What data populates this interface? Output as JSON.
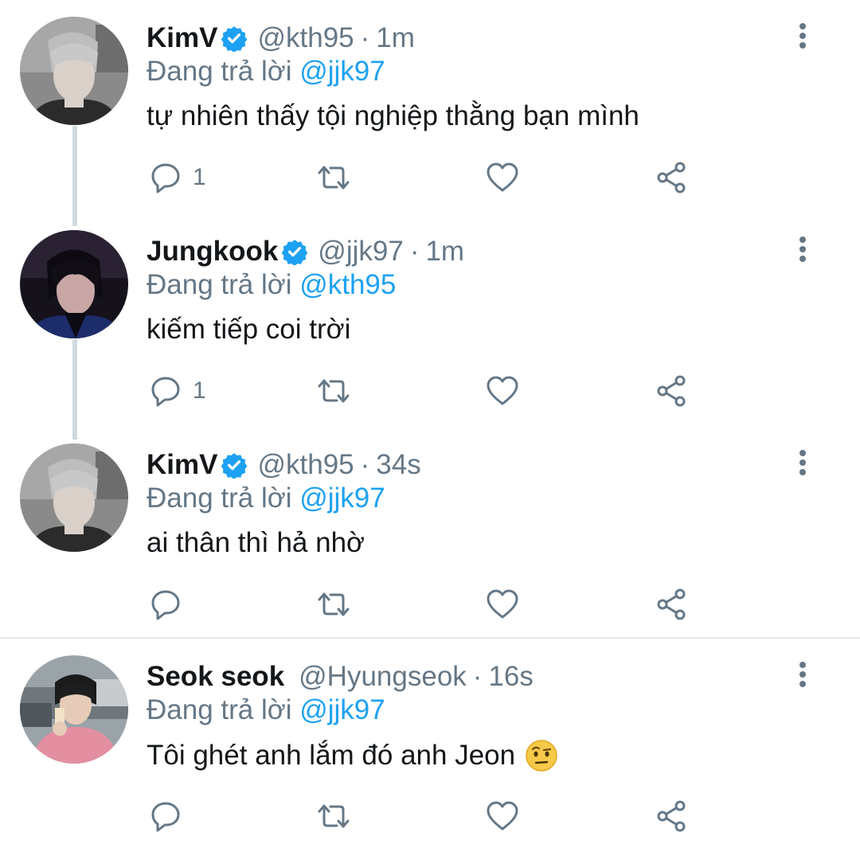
{
  "colors": {
    "text": "#14171a",
    "secondary": "#657786",
    "accent": "#1da1f2",
    "divider": "#e1e8ed"
  },
  "tweets": [
    {
      "name": "KimV",
      "verified": true,
      "handle": "@kth95",
      "separator": "·",
      "time": "1m",
      "replying_prefix": "Đang trả lời",
      "replying_to": "@jjk97",
      "text": "tự nhiên thấy tội nghiệp thằng bạn mình",
      "reply_count": "1",
      "avatar_icon": "avatar-photo"
    },
    {
      "name": "Jungkook",
      "verified": true,
      "handle": "@jjk97",
      "separator": "·",
      "time": "1m",
      "replying_prefix": "Đang trả lời",
      "replying_to": "@kth95",
      "text": "kiếm tiếp coi trời",
      "reply_count": "1",
      "avatar_icon": "avatar-photo"
    },
    {
      "name": "KimV",
      "verified": true,
      "handle": "@kth95",
      "separator": "·",
      "time": "34s",
      "replying_prefix": "Đang trả lời",
      "replying_to": "@jjk97",
      "text": "ai thân thì hả nhờ",
      "reply_count": "",
      "avatar_icon": "avatar-photo"
    },
    {
      "name": "Seok seok",
      "verified": false,
      "handle": "@Hyungseok",
      "separator": "·",
      "time": "16s",
      "replying_prefix": "Đang trả lời",
      "replying_to": "@jjk97",
      "text": "Tôi ghét anh lắm đó anh Jeon",
      "emoji": "raised-eyebrow-emoji",
      "reply_count": "",
      "avatar_icon": "avatar-photo"
    }
  ],
  "action_icons": [
    "reply-icon",
    "retweet-icon",
    "like-icon",
    "share-icon"
  ]
}
